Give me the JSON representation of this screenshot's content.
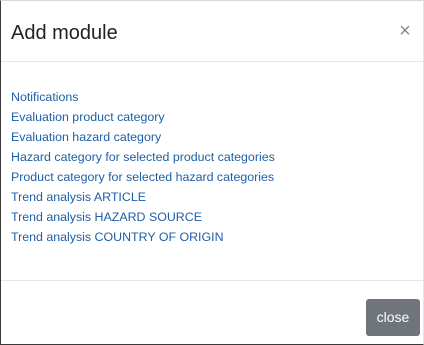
{
  "modal": {
    "title": "Add module",
    "close_icon_glyph": "×",
    "close_icon_name": "close-icon"
  },
  "modules": [
    {
      "label": "Notifications"
    },
    {
      "label": "Evaluation product category"
    },
    {
      "label": "Evaluation hazard category"
    },
    {
      "label": "Hazard category for selected product categories"
    },
    {
      "label": "Product category for selected hazard categories"
    },
    {
      "label": "Trend analysis ARTICLE"
    },
    {
      "label": "Trend analysis HAZARD SOURCE"
    },
    {
      "label": "Trend analysis COUNTRY OF ORIGIN"
    }
  ],
  "footer": {
    "close_label": "close"
  },
  "colors": {
    "link": "#1e5fa8",
    "close_button_bg": "#6f757b",
    "title_text": "#222222"
  }
}
